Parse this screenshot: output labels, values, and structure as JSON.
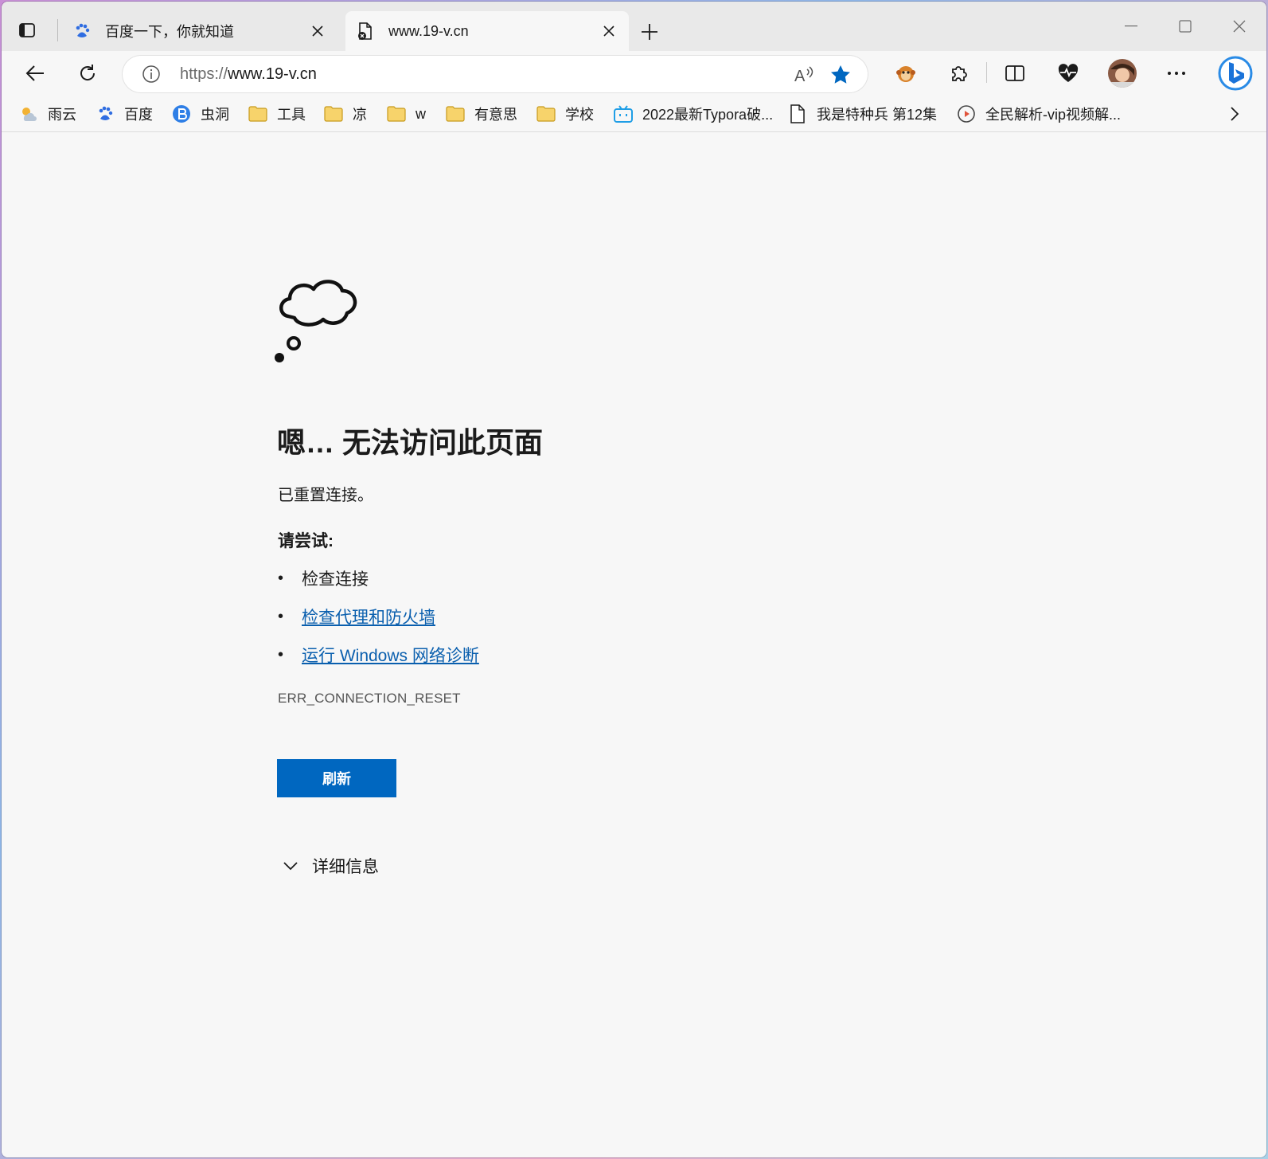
{
  "tabs": [
    {
      "title": "百度一下，你就知道",
      "favicon": "baidu-paw-icon"
    },
    {
      "title": "www.19-v.cn",
      "favicon": "page-error-icon"
    }
  ],
  "address": {
    "protocol": "https://",
    "host": "www.19-v.cn"
  },
  "bookmarks": [
    {
      "label": "雨云",
      "icon": "weather-icon"
    },
    {
      "label": "百度",
      "icon": "baidu-paw-icon"
    },
    {
      "label": "虫洞",
      "icon": "wormhole-icon"
    },
    {
      "label": "工具",
      "icon": "folder-icon"
    },
    {
      "label": "凉",
      "icon": "folder-icon"
    },
    {
      "label": "w",
      "icon": "folder-icon"
    },
    {
      "label": "有意思",
      "icon": "folder-icon"
    },
    {
      "label": "学校",
      "icon": "folder-icon"
    },
    {
      "label": "2022最新Typora破...",
      "icon": "bilibili-icon"
    },
    {
      "label": "我是特种兵 第12集",
      "icon": "document-icon"
    },
    {
      "label": "全民解析-vip视频解...",
      "icon": "play-circle-icon"
    }
  ],
  "error": {
    "title": "嗯… 无法访问此页面",
    "subtitle": "已重置连接。",
    "try_heading": "请尝试:",
    "suggestions": [
      {
        "text": "检查连接",
        "link": false
      },
      {
        "text": "检查代理和防火墙",
        "link": true
      },
      {
        "text": "运行 Windows 网络诊断",
        "link": true
      }
    ],
    "code": "ERR_CONNECTION_RESET",
    "refresh_label": "刷新",
    "details_label": "详细信息"
  },
  "colors": {
    "accent": "#0067c0",
    "link": "#0a5fae",
    "star": "#0067c0"
  }
}
